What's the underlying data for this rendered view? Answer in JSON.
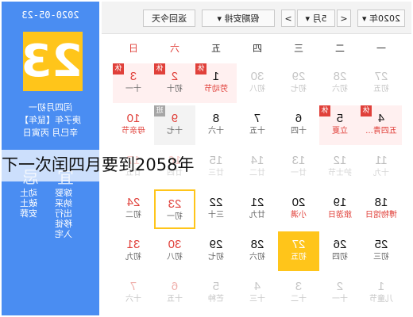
{
  "panel": {
    "date_text": "2020-05-23",
    "big_day": "23",
    "lunar_line": "闰四月初一",
    "ganzhi_line": "庚子年【鼠年】",
    "gz_day_line": "辛巳月 丙寅日",
    "yi_label": "宜",
    "ji_label": "忌",
    "yi_list": [
      "嫁娶",
      "纳采",
      "出行",
      "移徙",
      "入宅"
    ],
    "ji_list": [
      "动土",
      "破土",
      "安葬"
    ]
  },
  "toolbar": {
    "year_label": "2020年",
    "prev_arrow": "<",
    "month_label": "5月",
    "next_arrow": ">",
    "holiday_label": "假期安排",
    "today_label": "返回今天",
    "dropdown_arrow": "▾"
  },
  "weekdays": [
    "一",
    "二",
    "三",
    "四",
    "五",
    "六",
    "日"
  ],
  "calendar": [
    [
      {
        "num": "27",
        "lunar": "初五",
        "other": true
      },
      {
        "num": "28",
        "lunar": "初六",
        "other": true
      },
      {
        "num": "29",
        "lunar": "初七",
        "other": true
      },
      {
        "num": "30",
        "lunar": "初八",
        "other": true
      },
      {
        "num": "1",
        "lunar": "劳动节",
        "festival": true,
        "holiday": true,
        "badge": "休"
      },
      {
        "num": "2",
        "lunar": "初十",
        "holiday": true,
        "badge": "休",
        "weekend": true
      },
      {
        "num": "3",
        "lunar": "十一",
        "holiday": true,
        "badge": "休",
        "weekend": true
      }
    ],
    [
      {
        "num": "4",
        "lunar": "五四青...",
        "festival": true,
        "holiday": true,
        "badge": "休"
      },
      {
        "num": "5",
        "lunar": "立夏",
        "festival": true,
        "holiday": true,
        "badge": "休"
      },
      {
        "num": "6",
        "lunar": "十四"
      },
      {
        "num": "7",
        "lunar": "十五"
      },
      {
        "num": "8",
        "lunar": "十六"
      },
      {
        "num": "9",
        "lunar": "十七",
        "work": true,
        "badge": "班",
        "weekend": true
      },
      {
        "num": "10",
        "lunar": "母亲节",
        "festival": true,
        "weekend": true
      }
    ],
    [
      {
        "num": "11",
        "lunar": "十九"
      },
      {
        "num": "12",
        "lunar": "护士节"
      },
      {
        "num": "13",
        "lunar": "廿一"
      },
      {
        "num": "14",
        "lunar": "廿二"
      },
      {
        "num": "15",
        "lunar": "廿三"
      },
      {
        "num": "16",
        "lunar": "廿四",
        "weekend": true
      },
      {
        "num": "17",
        "lunar": "廿五",
        "weekend": true
      }
    ],
    [
      {
        "num": "18",
        "lunar": "博物馆日",
        "festival": true
      },
      {
        "num": "19",
        "lunar": "旅游日",
        "festival": true
      },
      {
        "num": "20",
        "lunar": "小满",
        "festival": true
      },
      {
        "num": "21",
        "lunar": "廿九"
      },
      {
        "num": "22",
        "lunar": "三十"
      },
      {
        "num": "23",
        "lunar": "初一",
        "selected": true,
        "weekend": true
      },
      {
        "num": "24",
        "lunar": "初二",
        "weekend": true
      }
    ],
    [
      {
        "num": "25",
        "lunar": "初三"
      },
      {
        "num": "26",
        "lunar": "初四"
      },
      {
        "num": "27",
        "lunar": "初五",
        "today": true
      },
      {
        "num": "28",
        "lunar": "初六"
      },
      {
        "num": "29",
        "lunar": "初七"
      },
      {
        "num": "30",
        "lunar": "初八",
        "weekend": true
      },
      {
        "num": "31",
        "lunar": "初九",
        "weekend": true
      }
    ],
    [
      {
        "num": "1",
        "lunar": "儿童节",
        "other": true
      },
      {
        "num": "2",
        "lunar": "十一",
        "other": true
      },
      {
        "num": "3",
        "lunar": "十二",
        "other": true
      },
      {
        "num": "4",
        "lunar": "十三",
        "other": true
      },
      {
        "num": "5",
        "lunar": "芒种",
        "other": true
      },
      {
        "num": "6",
        "lunar": "十五",
        "other": true,
        "weekend": true
      },
      {
        "num": "7",
        "lunar": "十六",
        "other": true,
        "weekend": true
      }
    ]
  ],
  "banner": {
    "text": "下一次闰四月要到2058年"
  },
  "colors": {
    "panel_bg": "#4a8df2",
    "accent": "#ffc51a",
    "holiday_red": "#e0403a"
  }
}
